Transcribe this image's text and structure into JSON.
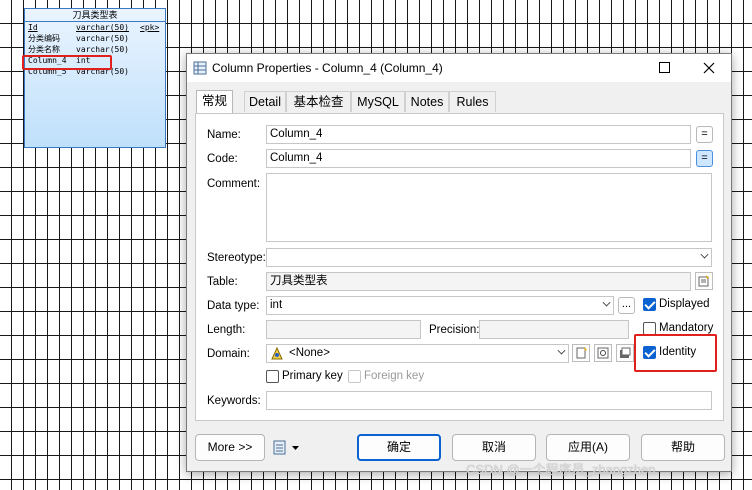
{
  "diagram": {
    "table_symbol": {
      "title": "刀具类型表",
      "rows": [
        {
          "name": "Id",
          "type": "varchar(50)",
          "key": "<pk>"
        },
        {
          "name": "分类编码",
          "type": "varchar(50)",
          "key": ""
        },
        {
          "name": "分类名称",
          "type": "varchar(50)",
          "key": ""
        },
        {
          "name": "Column_4",
          "type": "int",
          "key": ""
        },
        {
          "name": "Column_5",
          "type": "varchar(50)",
          "key": ""
        }
      ]
    }
  },
  "dialog": {
    "title": "Column Properties - Column_4 (Column_4)",
    "tabs": [
      "常规",
      "Detail",
      "基本检查",
      "MySQL",
      "Notes",
      "Rules"
    ],
    "active_tab": "常规",
    "form": {
      "name_label": "Name:",
      "name_value": "Column_4",
      "code_label": "Code:",
      "code_value": "Column_4",
      "comment_label": "Comment:",
      "comment_value": "",
      "stereotype_label": "Stereotype:",
      "stereotype_value": "",
      "table_label": "Table:",
      "table_value": "刀具类型表",
      "datatype_label": "Data type:",
      "datatype_value": "int",
      "ellipsis_label": "...",
      "displayed_label": "Displayed",
      "length_label": "Length:",
      "length_value": "",
      "precision_label": "Precision:",
      "precision_value": "",
      "mandatory_label": "Mandatory",
      "domain_label": "Domain:",
      "domain_value": "<None>",
      "identity_label": "Identity",
      "primary_key_label": "Primary key",
      "foreign_key_label": "Foreign key",
      "keywords_label": "Keywords:",
      "keywords_value": "",
      "equals_label": "="
    },
    "checkboxes": {
      "displayed": true,
      "mandatory": false,
      "identity": true,
      "primary_key": false,
      "foreign_key": false
    },
    "buttons": {
      "more": "More >>",
      "ok": "确定",
      "cancel": "取消",
      "apply": "应用(A)",
      "help": "帮助"
    }
  },
  "watermark": "CSDN @一个程序员_zhangzhen",
  "colors": {
    "accent": "#0a63d1",
    "highlight_box": "#e0201c",
    "table_symbol_fill": "#bfe0fb"
  }
}
